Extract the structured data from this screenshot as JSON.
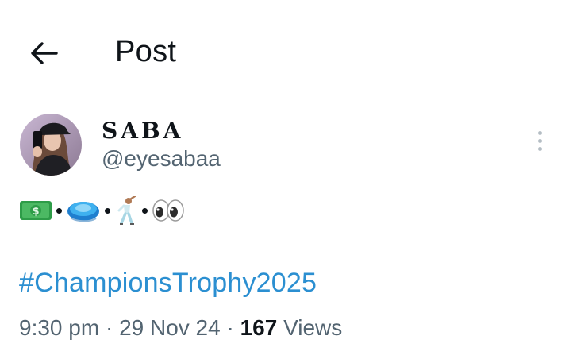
{
  "header": {
    "title": "Post",
    "back_icon": "arrow-left-icon"
  },
  "post": {
    "author": {
      "display_name": "SABA",
      "handle": "@eyesabaa",
      "avatar_icon": "avatar-photo"
    },
    "more_icon": "more-vertical-icon",
    "emojis": [
      "money-banknote-icon",
      "flying-disc-icon",
      "dancing-man-icon",
      "eyes-icon"
    ],
    "hashtag": "#ChampionsTrophy2025",
    "time": "9:30 pm",
    "date": "29 Nov 24",
    "views_count": "167",
    "views_label": "Views",
    "separator": " · "
  },
  "colors": {
    "link": "#2b8fd1",
    "secondary_text": "#536471",
    "primary_text": "#0f1419",
    "divider": "#e1e6ea"
  }
}
